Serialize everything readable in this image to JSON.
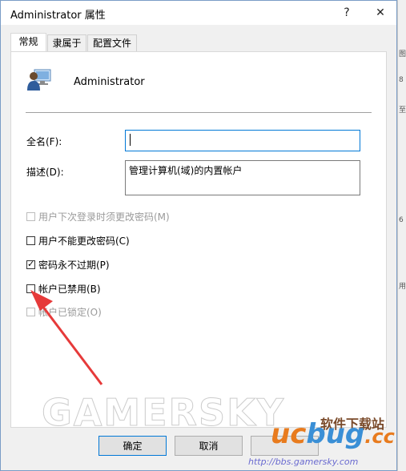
{
  "window": {
    "title": "Administrator 属性",
    "help": "?",
    "close": "✕"
  },
  "tabs": [
    {
      "label": "常规"
    },
    {
      "label": "隶属于"
    },
    {
      "label": "配置文件"
    }
  ],
  "user": {
    "name": "Administrator"
  },
  "fields": {
    "fullname": {
      "label": "全名(F):",
      "value": ""
    },
    "description": {
      "label": "描述(D):",
      "value": "管理计算机(域)的内置帐户"
    }
  },
  "checkboxes": [
    {
      "label": "用户下次登录时须更改密码(M)",
      "checked": false,
      "enabled": false
    },
    {
      "label": "用户不能更改密码(C)",
      "checked": false,
      "enabled": true
    },
    {
      "label": "密码永不过期(P)",
      "checked": true,
      "enabled": true
    },
    {
      "label": "帐户已禁用(B)",
      "checked": false,
      "enabled": true
    },
    {
      "label": "帐户已锁定(O)",
      "checked": false,
      "enabled": false
    }
  ],
  "buttons": {
    "ok": "确定",
    "cancel": "取消"
  },
  "watermarks": {
    "gamersky": "GAMERSKY",
    "site": "软件下载站",
    "brand_a": "uc",
    "brand_b": "bug",
    "brand_c": ".cc",
    "url": "http://bbs.gamersky.com"
  }
}
